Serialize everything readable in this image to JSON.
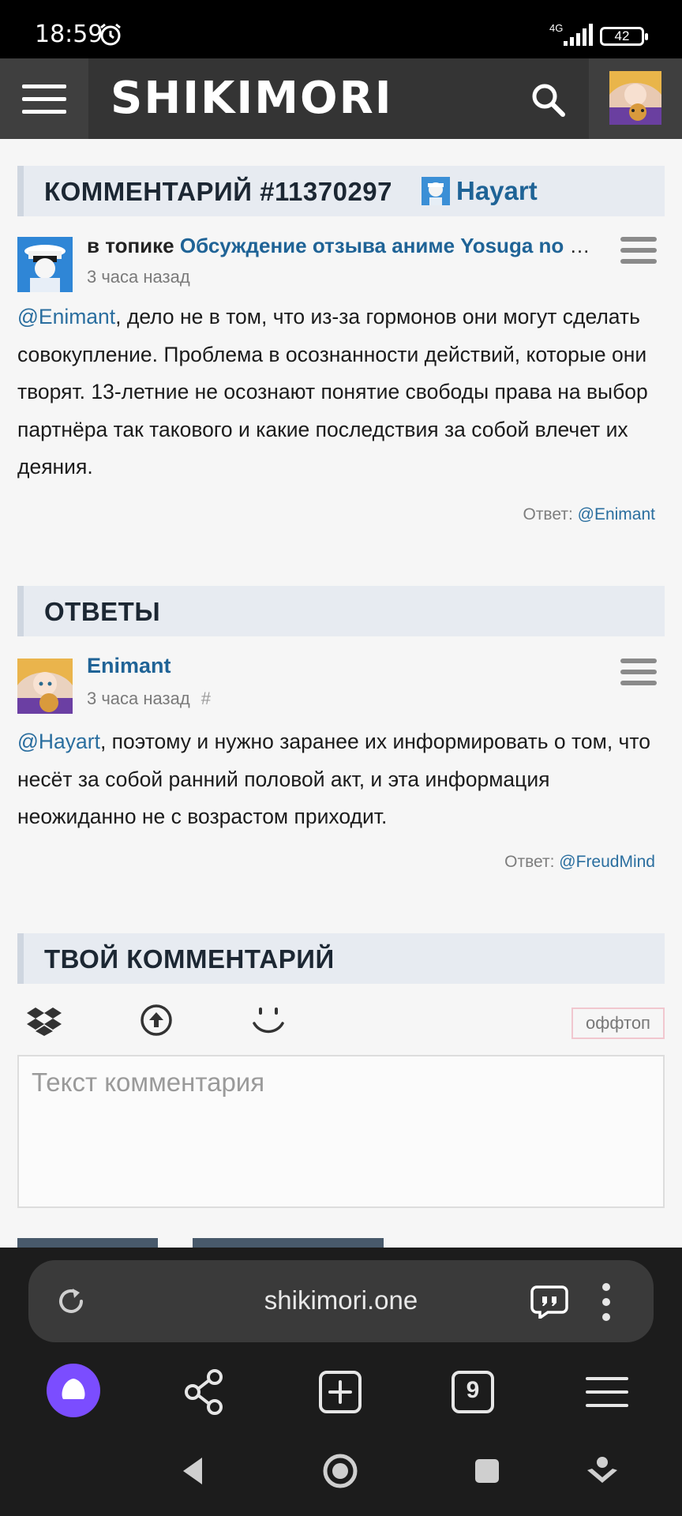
{
  "status_bar": {
    "time": "18:59",
    "network": "4G",
    "battery": "42"
  },
  "header": {
    "logo": "SHIKIMORI"
  },
  "comment_section": {
    "title": "КОММЕНТАРИЙ #11370297",
    "author": "Hayart",
    "topic_prefix": "в топике",
    "topic_link": "Обсуждение отзыва аниме Yosuga no Sora",
    "time": "3 часа назад",
    "mention": "@Enimant",
    "text": ", дело не в том, что из-за гормонов они могут сделать совокупление. Проблема в осознанности действий, которые они творят. 13-летние не осознают понятие свободы права на выбор партнёра так такового и какие последствия за собой влечет их деяния.",
    "reply_label": "Ответ:",
    "reply_to": "@Enimant"
  },
  "answers_section": {
    "title": "ОТВЕТЫ",
    "user": "Enimant",
    "time": "3 часа назад",
    "hash": "#",
    "mention": "@Hayart",
    "text": ", поэтому и нужно заранее их информировать о том, что несёт за собой ранний половой акт, и эта информация неожиданно не с возрастом приходит.",
    "reply_label": "Ответ:",
    "reply_to": "@FreudMind"
  },
  "your_comment": {
    "title": "ТВОЙ КОММЕНТАРИЙ",
    "offtopic": "оффтоп",
    "placeholder": "Текст комментария"
  },
  "browser": {
    "url": "shikimori.one",
    "tab_count": "9"
  },
  "colors": {
    "accent": "#1f6396",
    "header_bg": "#343434",
    "section_bg": "#e7ebf1",
    "alice": "#7b4dff"
  }
}
